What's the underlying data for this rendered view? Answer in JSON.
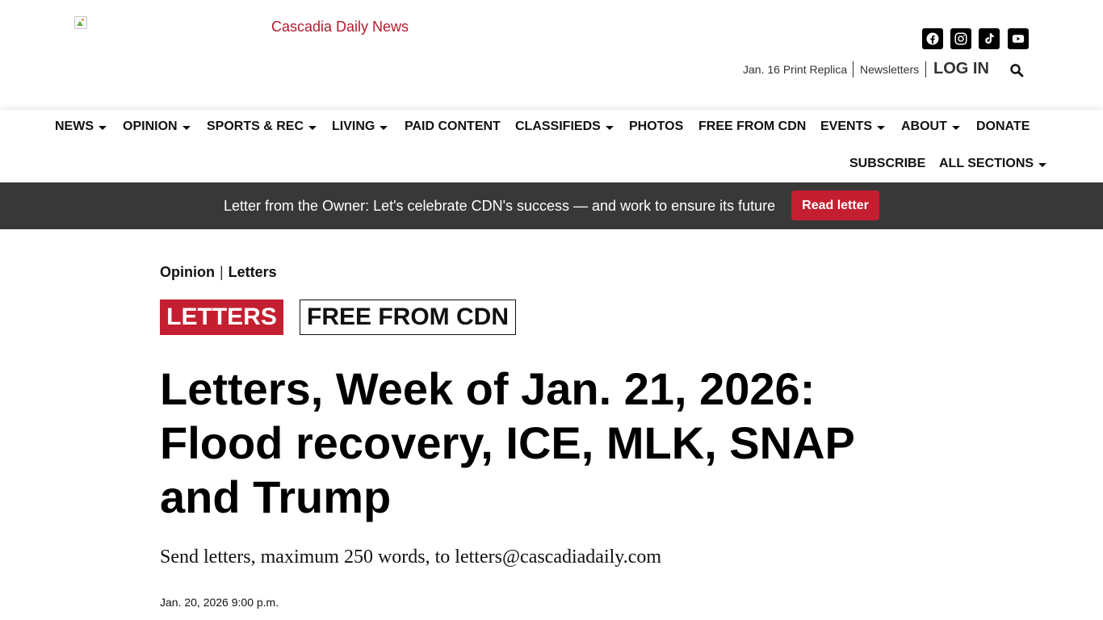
{
  "header": {
    "logo_alt": "Cascadia Daily News",
    "social": [
      "facebook-icon",
      "instagram-icon",
      "tiktok-icon",
      "youtube-icon"
    ],
    "util_links": [
      "Jan. 16 Print Replica",
      "Newsletters"
    ],
    "login_label": "LOG IN",
    "brand_color": "#c41f30"
  },
  "nav": {
    "items": [
      {
        "label": "NEWS",
        "dropdown": true
      },
      {
        "label": "OPINION",
        "dropdown": true
      },
      {
        "label": "SPORTS & REC",
        "dropdown": true
      },
      {
        "label": "LIVING",
        "dropdown": true
      },
      {
        "label": "PAID CONTENT",
        "dropdown": false
      },
      {
        "label": "CLASSIFIEDS",
        "dropdown": true
      },
      {
        "label": "PHOTOS",
        "dropdown": false
      },
      {
        "label": "FREE FROM CDN",
        "dropdown": false
      },
      {
        "label": "EVENTS",
        "dropdown": true
      },
      {
        "label": "ABOUT",
        "dropdown": true
      },
      {
        "label": "DONATE",
        "dropdown": false
      },
      {
        "label": "SUBSCRIBE",
        "dropdown": false
      },
      {
        "label": "ALL SECTIONS",
        "dropdown": true
      }
    ]
  },
  "banner": {
    "text": "Letter from the Owner: Let's celebrate CDN's success — and work to ensure its future",
    "button_label": "Read letter"
  },
  "article": {
    "breadcrumb": [
      "Opinion",
      "Letters"
    ],
    "breadcrumb_separator": "|",
    "tags": [
      "LETTERS",
      "FREE FROM CDN"
    ],
    "headline": "Letters, Week of Jan. 21, 2026: Flood recovery, ICE, MLK, SNAP and Trump",
    "dek": "Send letters, maximum 250 words, to letters@cascadiadaily.com",
    "dateline": "Jan. 20, 2026 9:00 p.m."
  }
}
